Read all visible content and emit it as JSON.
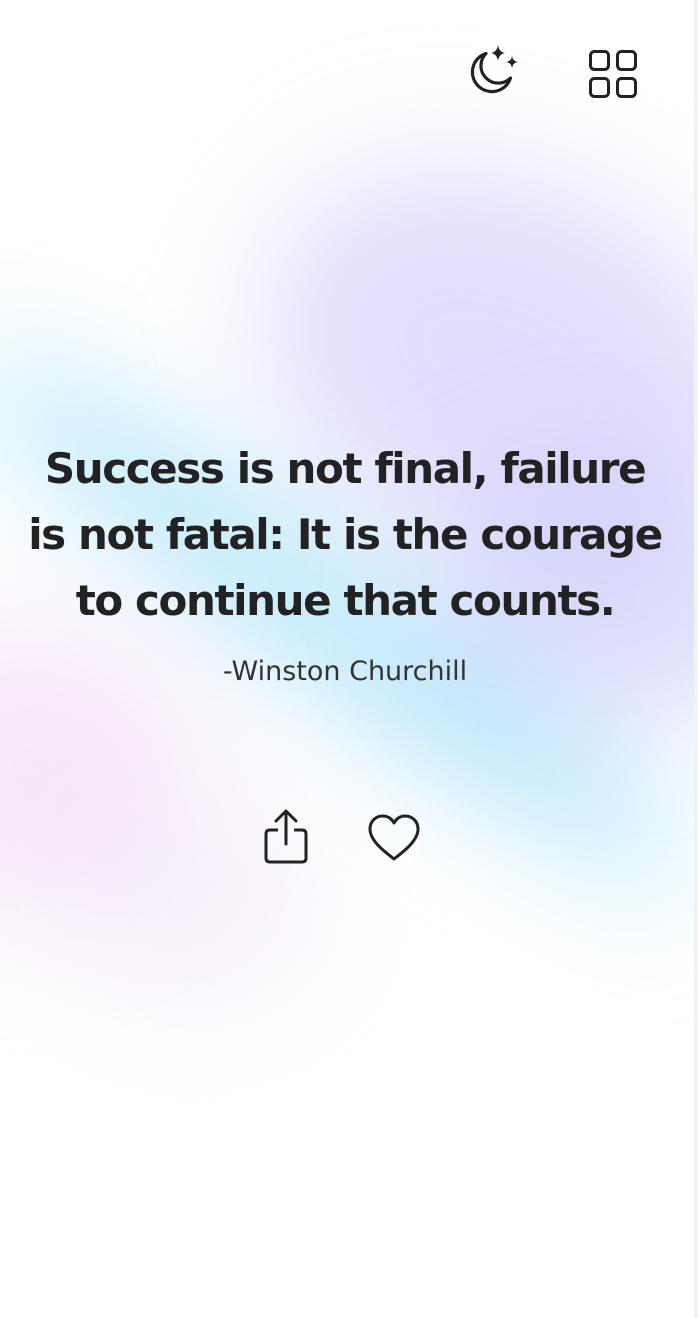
{
  "theme": {
    "background": "#ffffff",
    "text_color": "#222222",
    "author_color": "#333333",
    "gradient_colors": [
      "#78d2f5",
      "#c8c3fa",
      "#f2d7f5"
    ]
  },
  "header": {
    "theme_toggle_icon": "moon-stars-icon",
    "menu_icon": "grid-icon"
  },
  "quote": {
    "text": "Success is not final, failure is not fatal: It is the courage to continue that counts.",
    "author": "-Winston Churchill"
  },
  "actions": {
    "share_icon": "share-icon",
    "like_icon": "heart-icon"
  }
}
